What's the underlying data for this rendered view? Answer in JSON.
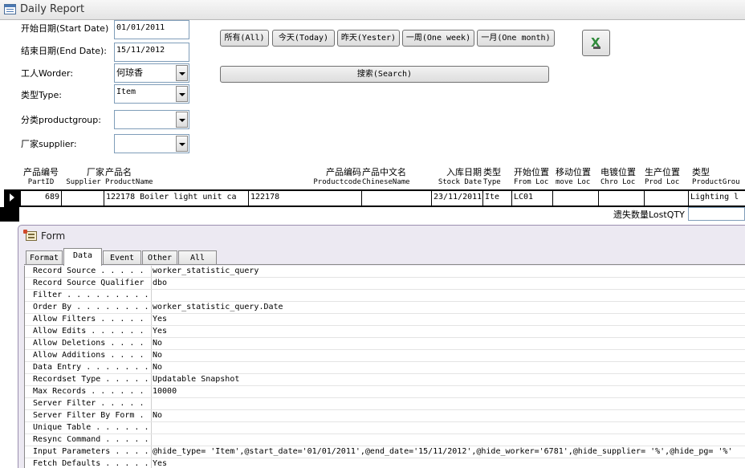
{
  "window": {
    "title": "Daily Report"
  },
  "filters": {
    "start_date": {
      "label": "开始日期(Start Date)",
      "value": "01/01/2011"
    },
    "end_date": {
      "label": "结束日期(End Date):",
      "value": "15/11/2012"
    },
    "worker": {
      "label": "工人Worder:",
      "value": "何琼香"
    },
    "type": {
      "label": "类型Type:",
      "value": "Item"
    },
    "productgroup": {
      "label": "分类productgroup:",
      "value": ""
    },
    "supplier": {
      "label": "厂家supplier:",
      "value": ""
    }
  },
  "buttons": {
    "all": "所有(All)",
    "today": "今天(Today)",
    "yesterday": "昨天(Yester)",
    "one_week": "一周(One week)",
    "one_month": "一月(One month)",
    "search": "搜索(Search)",
    "export_icon": "excel-export-icon"
  },
  "grid": {
    "headers": {
      "partid": {
        "cn": "产品编号",
        "en": "PartID"
      },
      "supplier": {
        "cn": "厂家",
        "en": "Supplier"
      },
      "productname": {
        "cn": "产品名",
        "en": "ProductName"
      },
      "productcode": {
        "cn": "产品编码",
        "en": "Productcode"
      },
      "chinesename": {
        "cn": "产品中文名",
        "en": "ChineseName"
      },
      "stockdate": {
        "cn": "入库日期",
        "en": "Stock Date"
      },
      "type": {
        "cn": "类型",
        "en": "Type"
      },
      "fromloc": {
        "cn": "开始位置",
        "en": "From Loc"
      },
      "moveloc": {
        "cn": "移动位置",
        "en": "move Loc"
      },
      "chroloc": {
        "cn": "电镀位置",
        "en": "Chro Loc"
      },
      "prodloc": {
        "cn": "生产位置",
        "en": "Prod Loc"
      },
      "productgroup": {
        "cn": "类型",
        "en": "ProductGrou"
      }
    },
    "row": {
      "partid": "689",
      "supplier": "",
      "productname": "122178 Boiler light unit ca",
      "productcode": "122178",
      "chinesename": "",
      "stockdate": "23/11/2011",
      "type": "Ite",
      "fromloc": "LC01",
      "moveloc": "",
      "chroloc": "",
      "prodloc": "",
      "productgroup": "Lighting l"
    },
    "lost_qty_label": "遗失数量LostQTY",
    "lost_qty_value": ""
  },
  "property_sheet": {
    "title": "Form",
    "tabs": [
      "Format",
      "Data",
      "Event",
      "Other",
      "All"
    ],
    "active_tab": "Data",
    "rows": [
      {
        "name": "Record Source . . . . .",
        "value": "worker_statistic_query"
      },
      {
        "name": "Record Source Qualifier",
        "value": "dbo"
      },
      {
        "name": "Filter . . . . . . . . .",
        "value": ""
      },
      {
        "name": "Order By . . . . . . . .",
        "value": "worker_statistic_query.Date"
      },
      {
        "name": "Allow Filters . . . . .",
        "value": "Yes"
      },
      {
        "name": "Allow Edits . . . . . .",
        "value": "Yes"
      },
      {
        "name": "Allow Deletions . . . .",
        "value": "No"
      },
      {
        "name": "Allow Additions . . . .",
        "value": "No"
      },
      {
        "name": "Data Entry . . . . . . .",
        "value": "No"
      },
      {
        "name": "Recordset Type . . . . .",
        "value": "Updatable Snapshot"
      },
      {
        "name": "Max Records . . . . . .",
        "value": "10000"
      },
      {
        "name": "Server Filter . . . . .",
        "value": ""
      },
      {
        "name": "Server Filter By Form .",
        "value": "No"
      },
      {
        "name": "Unique Table . . . . . .",
        "value": ""
      },
      {
        "name": "Resync Command . . . . .",
        "value": ""
      },
      {
        "name": "Input Parameters . . . .",
        "value": "@hide_type= 'Item',@start_date='01/01/2011',@end_date='15/11/2012',@hide_worker='6781',@hide_supplier= '%',@hide_pg= '%'"
      },
      {
        "name": "Fetch Defaults . . . . .",
        "value": "Yes"
      }
    ]
  }
}
